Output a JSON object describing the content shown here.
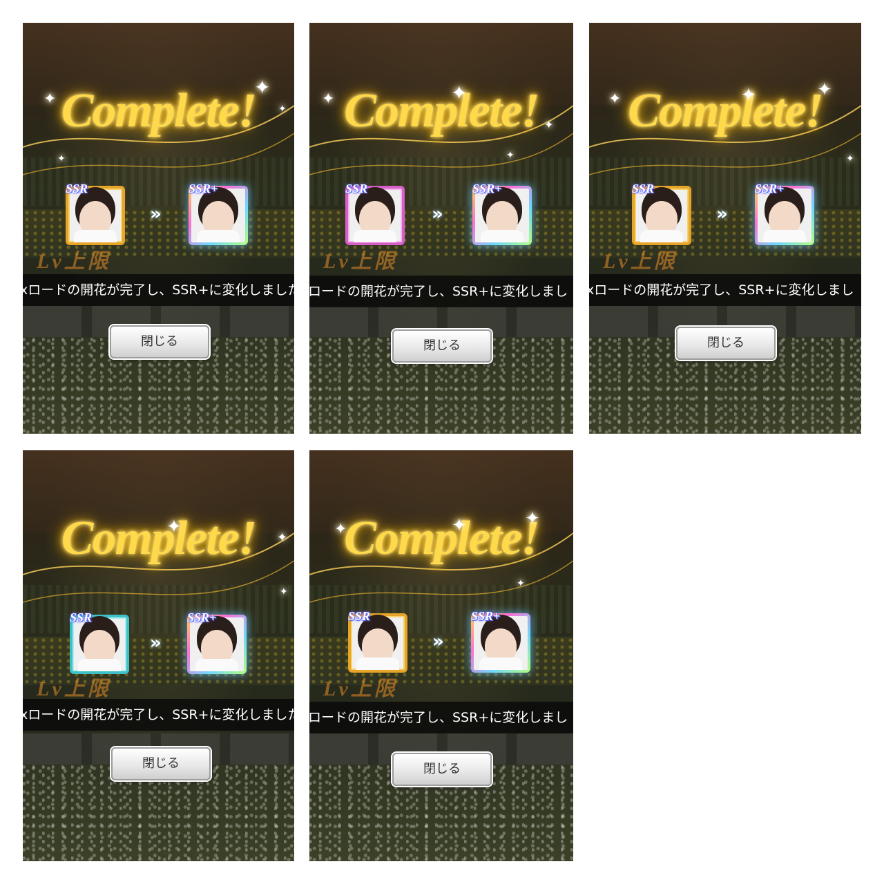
{
  "panels": [
    {
      "title": "Complete!",
      "badge_before": "SSR",
      "badge_after": "SSR+",
      "arrow_glyph": "»",
      "message": "xロードの開花が完了し、SSR+に変化しました",
      "close_label": "閉じる",
      "frame_before": "gold",
      "frame_after": "rainbow",
      "bg_sign": "Lv上限"
    },
    {
      "title": "Complete!",
      "badge_before": "SSR",
      "badge_after": "SSR+",
      "arrow_glyph": "»",
      "message": "ロードの開花が完了し、SSR+に変化しまし",
      "close_label": "閉じる",
      "frame_before": "pink",
      "frame_after": "rainbow",
      "bg_sign": "Lv上限"
    },
    {
      "title": "Complete!",
      "badge_before": "SSR",
      "badge_after": "SSR+",
      "arrow_glyph": "»",
      "message": "xロードの開花が完了し、SSR+に変化しまし",
      "close_label": "閉じる",
      "frame_before": "gold",
      "frame_after": "rainbow",
      "bg_sign": "Lv上限"
    },
    {
      "title": "Complete!",
      "badge_before": "SSR",
      "badge_after": "SSR+",
      "arrow_glyph": "»",
      "message": "xロードの開花が完了し、SSR+に変化しました",
      "close_label": "閉じる",
      "frame_before": "teal",
      "frame_after": "rainbow",
      "bg_sign": "Lv上限"
    },
    {
      "title": "Complete!",
      "badge_before": "SSR",
      "badge_after": "SSR+",
      "arrow_glyph": "»",
      "message": "ロードの開花が完了し、SSR+に変化しまし",
      "close_label": "閉じる",
      "frame_before": "gold",
      "frame_after": "rainbow",
      "bg_sign": "Lv上限"
    }
  ],
  "colors": {
    "title_gold": "#ffd94a",
    "message_bar": "#0a0a0a",
    "button_bg": "#ececec"
  }
}
